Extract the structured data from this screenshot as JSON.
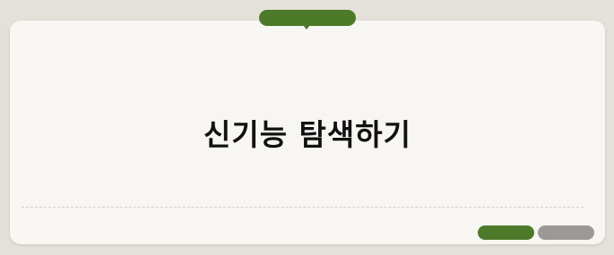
{
  "header": {
    "tab_label": ""
  },
  "main": {
    "title": "신기능 탐색하기",
    "faint_text": ""
  },
  "footer": {
    "primary_label": "",
    "secondary_label": ""
  },
  "colors": {
    "background": "#e3e1d9",
    "card": "#f7f6f2",
    "accent_green": "#4d7a29",
    "secondary_gray": "#9b9995",
    "title_text": "#111111"
  }
}
